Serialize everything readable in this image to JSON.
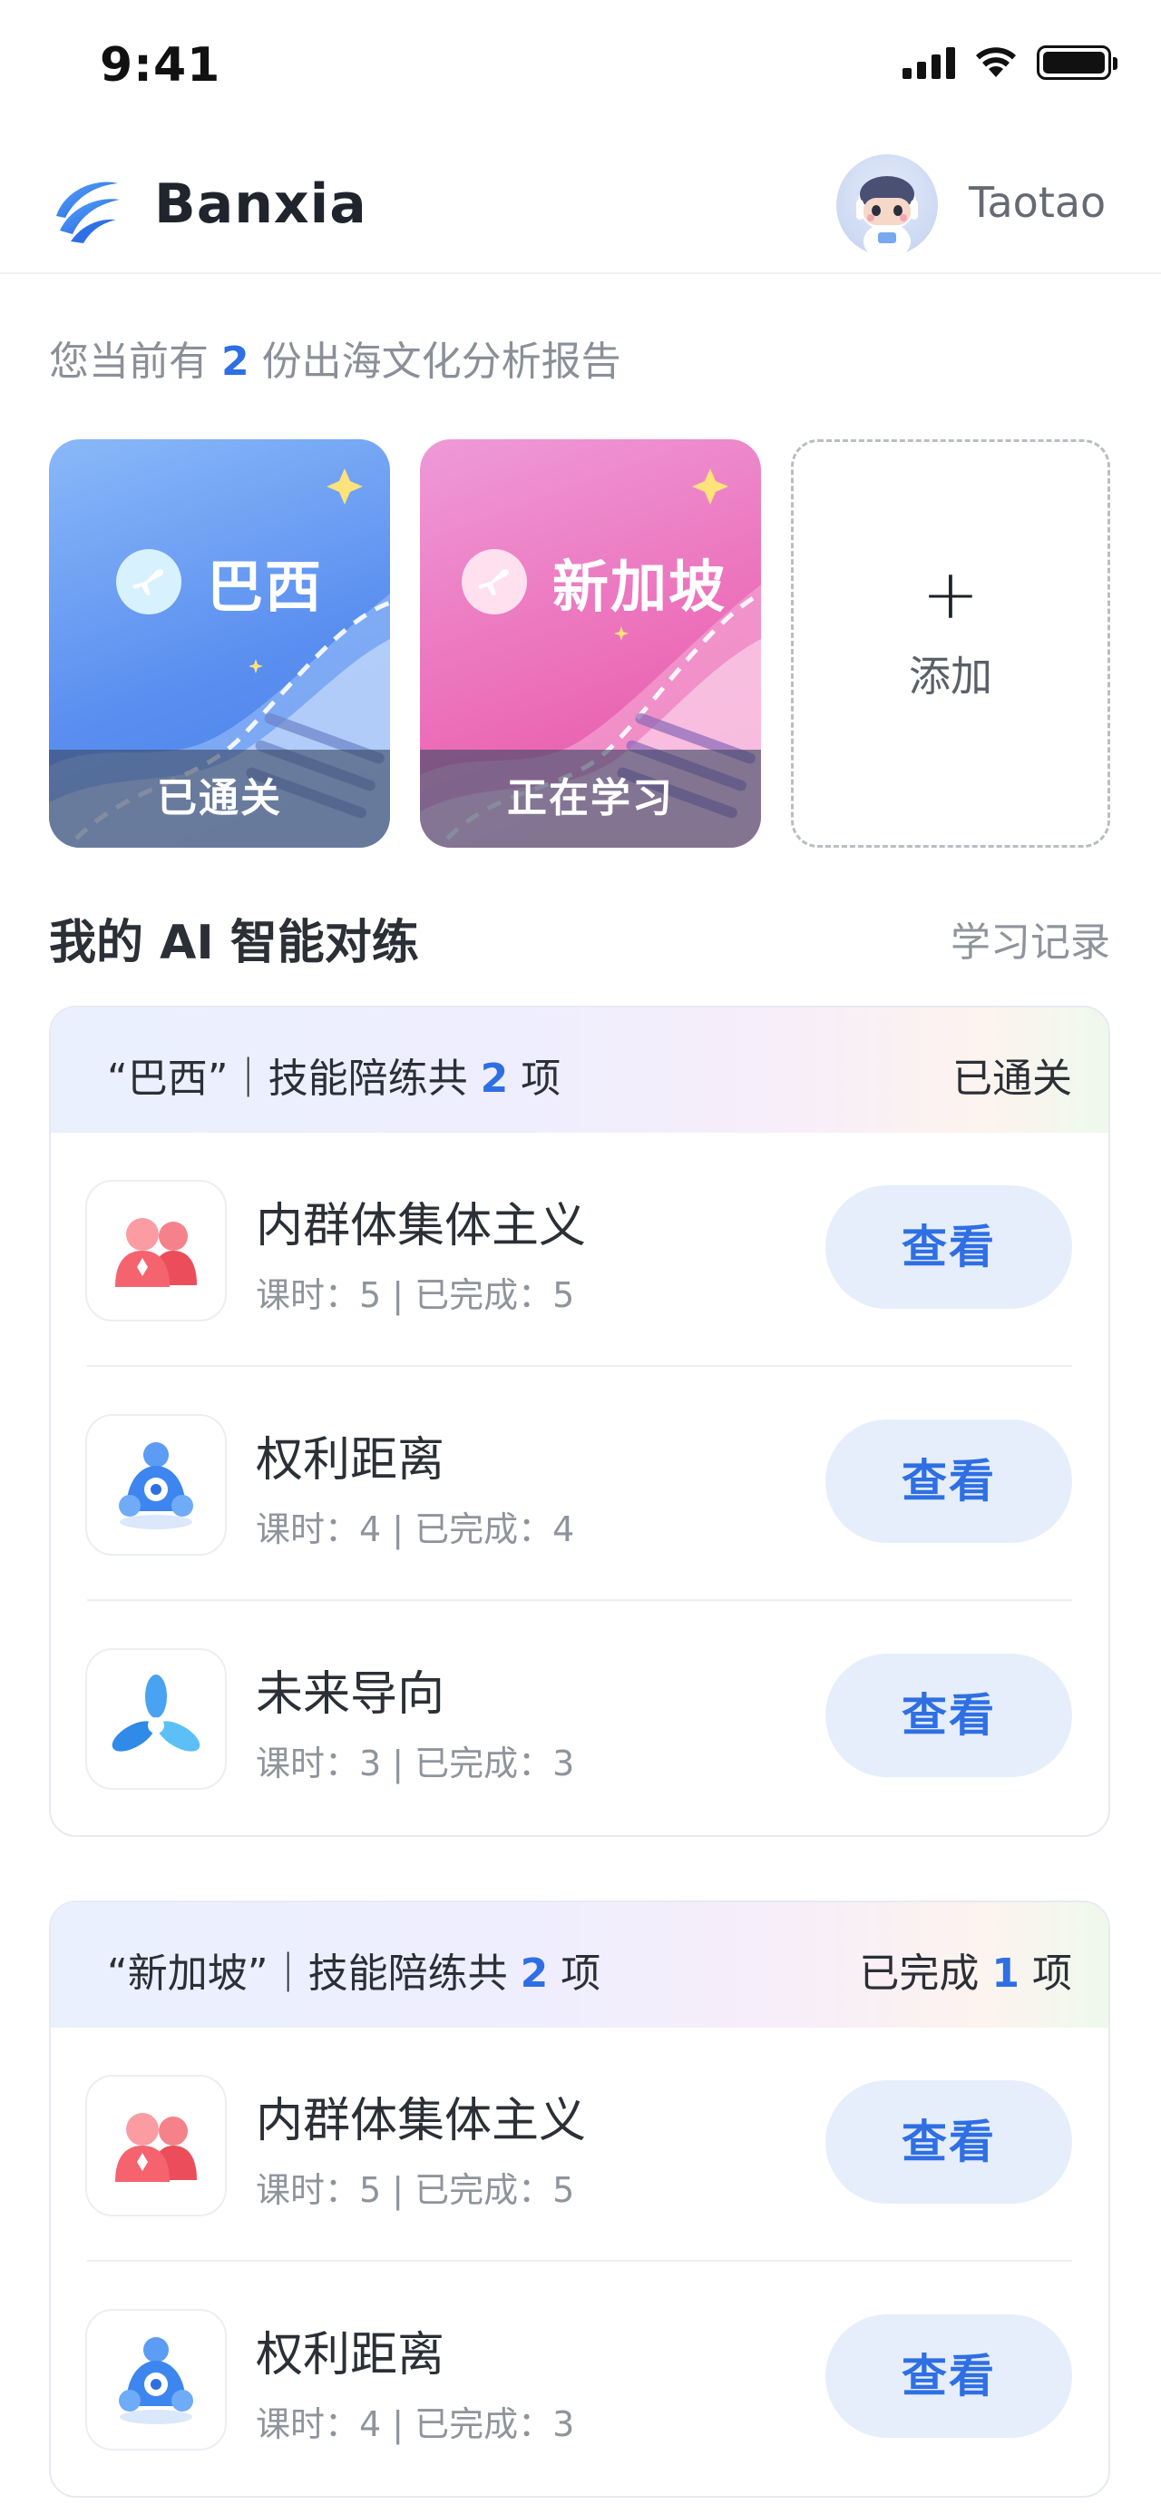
{
  "status_bar": {
    "time": "9:41"
  },
  "header": {
    "app_name": "Banxia",
    "username": "Taotao"
  },
  "report": {
    "prefix": "您当前有",
    "count": "2",
    "suffix": "份出海文化分析报告"
  },
  "cards": [
    {
      "name": "巴西",
      "status": "已通关"
    },
    {
      "name": "新加坡",
      "status": "正在学习"
    }
  ],
  "add_card": {
    "plus": "+",
    "label": "添加"
  },
  "section": {
    "title": "我的 AI 智能对练",
    "link": "学习记录"
  },
  "groups": [
    {
      "country": "“巴西”",
      "mid": "｜技能陪练共",
      "count": "2",
      "unit": "项",
      "status": "已通关",
      "skills": [
        {
          "name": "内群体集体主义",
          "meta": "课时：5 | 已完成：5",
          "button": "查看"
        },
        {
          "name": "权利距离",
          "meta": "课时：4 | 已完成：4",
          "button": "查看"
        },
        {
          "name": "未来导向",
          "meta": "课时：3 | 已完成：3",
          "button": "查看"
        }
      ]
    },
    {
      "country": "“新加坡”",
      "mid": "｜技能陪练共",
      "count": "2",
      "unit": "项",
      "status_prefix": "已完成",
      "status_count": "1",
      "status_unit": "项",
      "skills": [
        {
          "name": "内群体集体主义",
          "meta": "课时：5 | 已完成：5",
          "button": "查看"
        },
        {
          "name": "权利距离",
          "meta": "课时：4 | 已完成：3",
          "button": "查看"
        }
      ]
    }
  ],
  "icons": {
    "logo": "banxia-logo-icon",
    "plane": "airplane-icon",
    "skill_1": "people-group-icon",
    "skill_2": "power-distance-icon",
    "skill_3": "future-orientation-icon"
  },
  "colors": {
    "accent": "#2f6fe4",
    "button_bg": "#e6eefc",
    "brazil": "#5a8ff0",
    "singapore": "#ec6fb9"
  }
}
